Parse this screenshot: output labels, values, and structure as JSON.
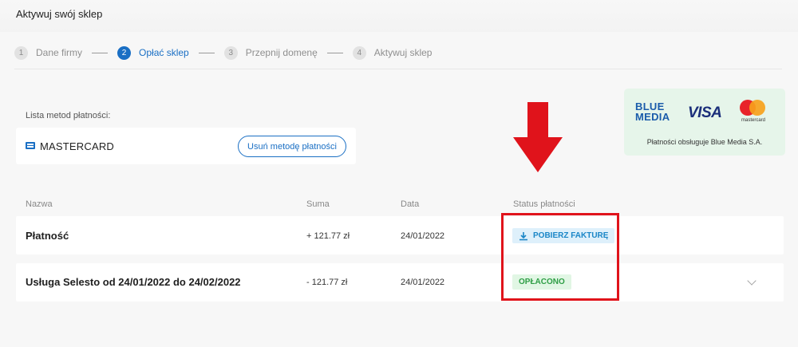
{
  "page": {
    "title": "Aktywuj swój sklep"
  },
  "stepper": [
    {
      "num": "1",
      "label": "Dane firmy"
    },
    {
      "num": "2",
      "label": "Opłać sklep"
    },
    {
      "num": "3",
      "label": "Przepnij domenę"
    },
    {
      "num": "4",
      "label": "Aktywuj sklep"
    }
  ],
  "active_step": 2,
  "payment_methods": {
    "heading": "Lista metod płatności:",
    "method_name": "MASTERCARD",
    "remove_button": "Usuń metodę płatności"
  },
  "provider": {
    "blue_media_line1": "BLUE",
    "blue_media_line2": "MEDIA",
    "visa": "VISA",
    "mastercard": "mastercard",
    "caption": "Płatności obsługuje Blue Media S.A."
  },
  "table": {
    "columns": {
      "name": "Nazwa",
      "amount": "Suma",
      "date": "Data",
      "status": "Status płatności"
    },
    "rows": [
      {
        "name": "Płatność",
        "amount": "+ 121.77 zł",
        "date": "24/01/2022",
        "status": "POBIERZ FAKTURĘ"
      },
      {
        "name": "Usługa Selesto od 24/01/2022 do 24/02/2022",
        "amount": "- 121.77 zł",
        "date": "24/01/2022",
        "status": "OPŁACONO"
      }
    ]
  },
  "colors": {
    "accent": "#1a6fc4",
    "annotation_red": "#e0131b",
    "paid_green": "#2e9e45",
    "invoice_blue": "#1a86c7",
    "provider_bg": "#e6f5ea"
  }
}
